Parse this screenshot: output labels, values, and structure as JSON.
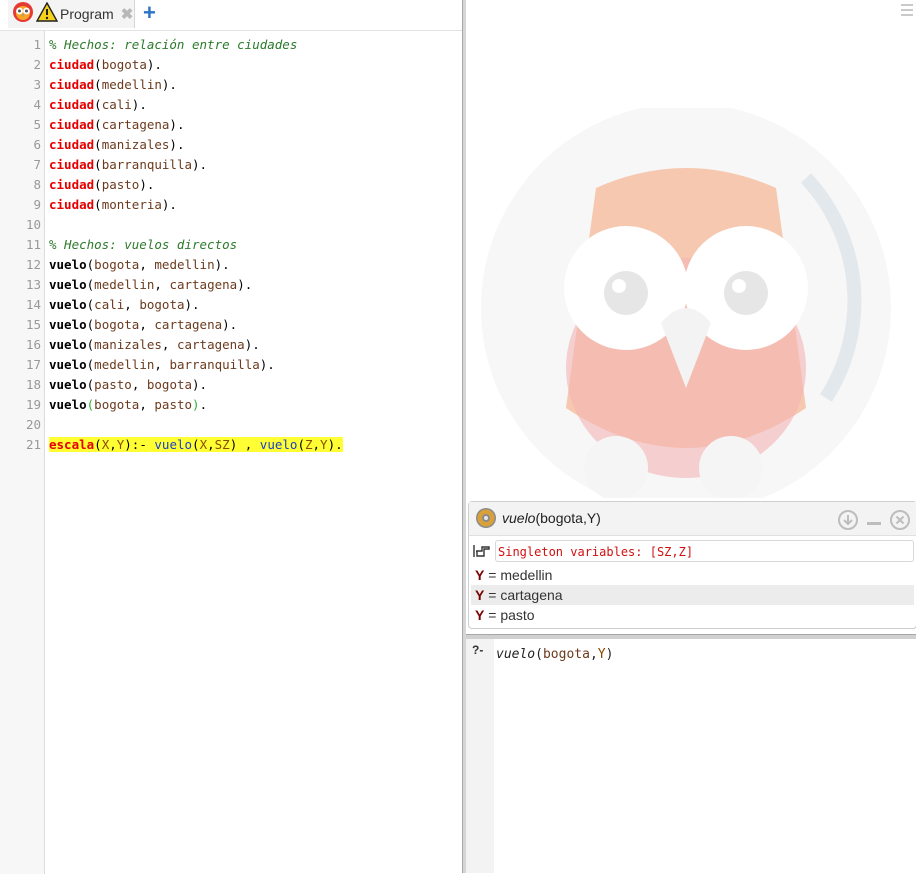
{
  "tab": {
    "label": "Program"
  },
  "code_lines": [
    {
      "n": "1",
      "tokens": [
        {
          "c": "cm",
          "t": "% Hechos: relación entre ciudades"
        }
      ]
    },
    {
      "n": "2",
      "tokens": [
        {
          "c": "kw",
          "t": "ciudad"
        },
        {
          "c": "pn",
          "t": "("
        },
        {
          "c": "at",
          "t": "bogota"
        },
        {
          "c": "pn",
          "t": ")."
        }
      ]
    },
    {
      "n": "3",
      "tokens": [
        {
          "c": "kw",
          "t": "ciudad"
        },
        {
          "c": "pn",
          "t": "("
        },
        {
          "c": "at",
          "t": "medellin"
        },
        {
          "c": "pn",
          "t": ")."
        }
      ]
    },
    {
      "n": "4",
      "tokens": [
        {
          "c": "kw",
          "t": "ciudad"
        },
        {
          "c": "pn",
          "t": "("
        },
        {
          "c": "at",
          "t": "cali"
        },
        {
          "c": "pn",
          "t": ")."
        }
      ]
    },
    {
      "n": "5",
      "tokens": [
        {
          "c": "kw",
          "t": "ciudad"
        },
        {
          "c": "pn",
          "t": "("
        },
        {
          "c": "at",
          "t": "cartagena"
        },
        {
          "c": "pn",
          "t": ")."
        }
      ]
    },
    {
      "n": "6",
      "tokens": [
        {
          "c": "kw",
          "t": "ciudad"
        },
        {
          "c": "pn",
          "t": "("
        },
        {
          "c": "at",
          "t": "manizales"
        },
        {
          "c": "pn",
          "t": ")."
        }
      ]
    },
    {
      "n": "7",
      "tokens": [
        {
          "c": "kw",
          "t": "ciudad"
        },
        {
          "c": "pn",
          "t": "("
        },
        {
          "c": "at",
          "t": "barranquilla"
        },
        {
          "c": "pn",
          "t": ")."
        }
      ]
    },
    {
      "n": "8",
      "tokens": [
        {
          "c": "kw",
          "t": "ciudad"
        },
        {
          "c": "pn",
          "t": "("
        },
        {
          "c": "at",
          "t": "pasto"
        },
        {
          "c": "pn",
          "t": ")."
        }
      ]
    },
    {
      "n": "9",
      "tokens": [
        {
          "c": "kw",
          "t": "ciudad"
        },
        {
          "c": "pn",
          "t": "("
        },
        {
          "c": "at",
          "t": "monteria"
        },
        {
          "c": "pn",
          "t": ")."
        }
      ]
    },
    {
      "n": "10",
      "tokens": []
    },
    {
      "n": "11",
      "tokens": [
        {
          "c": "cm",
          "t": "% Hechos: vuelos directos"
        }
      ]
    },
    {
      "n": "12",
      "tokens": [
        {
          "c": "pd",
          "t": "vuelo"
        },
        {
          "c": "pn",
          "t": "("
        },
        {
          "c": "at",
          "t": "bogota"
        },
        {
          "c": "pn",
          "t": ", "
        },
        {
          "c": "at",
          "t": "medellin"
        },
        {
          "c": "pn",
          "t": ")."
        }
      ]
    },
    {
      "n": "13",
      "tokens": [
        {
          "c": "pd",
          "t": "vuelo"
        },
        {
          "c": "pn",
          "t": "("
        },
        {
          "c": "at",
          "t": "medellin"
        },
        {
          "c": "pn",
          "t": ", "
        },
        {
          "c": "at",
          "t": "cartagena"
        },
        {
          "c": "pn",
          "t": ")."
        }
      ]
    },
    {
      "n": "14",
      "tokens": [
        {
          "c": "pd",
          "t": "vuelo"
        },
        {
          "c": "pn",
          "t": "("
        },
        {
          "c": "at",
          "t": "cali"
        },
        {
          "c": "pn",
          "t": ", "
        },
        {
          "c": "at",
          "t": "bogota"
        },
        {
          "c": "pn",
          "t": ")."
        }
      ]
    },
    {
      "n": "15",
      "tokens": [
        {
          "c": "pd",
          "t": "vuelo"
        },
        {
          "c": "pn",
          "t": "("
        },
        {
          "c": "at",
          "t": "bogota"
        },
        {
          "c": "pn",
          "t": ", "
        },
        {
          "c": "at",
          "t": "cartagena"
        },
        {
          "c": "pn",
          "t": ")."
        }
      ]
    },
    {
      "n": "16",
      "tokens": [
        {
          "c": "pd",
          "t": "vuelo"
        },
        {
          "c": "pn",
          "t": "("
        },
        {
          "c": "at",
          "t": "manizales"
        },
        {
          "c": "pn",
          "t": ", "
        },
        {
          "c": "at",
          "t": "cartagena"
        },
        {
          "c": "pn",
          "t": ")."
        }
      ]
    },
    {
      "n": "17",
      "tokens": [
        {
          "c": "pd",
          "t": "vuelo"
        },
        {
          "c": "pn",
          "t": "("
        },
        {
          "c": "at",
          "t": "medellin"
        },
        {
          "c": "pn",
          "t": ", "
        },
        {
          "c": "at",
          "t": "barranquilla"
        },
        {
          "c": "pn",
          "t": ")."
        }
      ]
    },
    {
      "n": "18",
      "tokens": [
        {
          "c": "pd",
          "t": "vuelo"
        },
        {
          "c": "pn",
          "t": "("
        },
        {
          "c": "at",
          "t": "pasto"
        },
        {
          "c": "pn",
          "t": ", "
        },
        {
          "c": "at",
          "t": "bogota"
        },
        {
          "c": "pn",
          "t": ")."
        }
      ]
    },
    {
      "n": "19",
      "tokens": [
        {
          "c": "pd",
          "t": "vuelo"
        },
        {
          "c": "gp",
          "t": "("
        },
        {
          "c": "at",
          "t": "bogota"
        },
        {
          "c": "pn",
          "t": ", "
        },
        {
          "c": "at",
          "t": "pasto"
        },
        {
          "c": "gp",
          "t": ")"
        },
        {
          "c": "pn",
          "t": "."
        }
      ]
    },
    {
      "n": "20",
      "tokens": []
    },
    {
      "n": "21",
      "highlight": true,
      "tokens": [
        {
          "c": "kw",
          "t": "escala"
        },
        {
          "c": "pn",
          "t": "("
        },
        {
          "c": "vr",
          "t": "X"
        },
        {
          "c": "pn",
          "t": ","
        },
        {
          "c": "vr",
          "t": "Y"
        },
        {
          "c": "pn",
          "t": "):- "
        },
        {
          "c": "bc",
          "t": "vuelo"
        },
        {
          "c": "pn",
          "t": "("
        },
        {
          "c": "vr",
          "t": "X"
        },
        {
          "c": "pn",
          "t": ","
        },
        {
          "c": "vr",
          "t": "SZ"
        },
        {
          "c": "pn",
          "t": ") , "
        },
        {
          "c": "bc",
          "t": "vuelo"
        },
        {
          "c": "pn",
          "t": "("
        },
        {
          "c": "vr",
          "t": "Z"
        },
        {
          "c": "pn",
          "t": ","
        },
        {
          "c": "vr",
          "t": "Y"
        },
        {
          "c": "pn",
          "t": ")."
        }
      ]
    }
  ],
  "answer": {
    "query_functor": "vuelo",
    "query_args": "(bogota,Y)",
    "warning": "Singleton variables: [SZ,Z]",
    "solutions": [
      {
        "var": "Y",
        "eq": " = ",
        "val": "medellin"
      },
      {
        "var": "Y",
        "eq": " = ",
        "val": "cartagena"
      },
      {
        "var": "Y",
        "eq": " = ",
        "val": "pasto"
      }
    ]
  },
  "prompt": {
    "label": "?-",
    "functor": "vuelo",
    "open": "(",
    "atom": "bogota",
    "comma": ",",
    "var": "Y",
    "close": ")"
  },
  "colors": {
    "accent": "#2a73c9",
    "keyword": "#e60000",
    "comment": "#2b7a2b",
    "highlight": "#ffff33",
    "warning": "#d01010"
  },
  "icons": [
    "swish-owl-icon",
    "warning-icon",
    "close-icon",
    "plus-icon",
    "menu-icon",
    "gear-icon",
    "download-icon",
    "minimize-icon",
    "close-circle-icon",
    "hand-pointer-icon"
  ]
}
